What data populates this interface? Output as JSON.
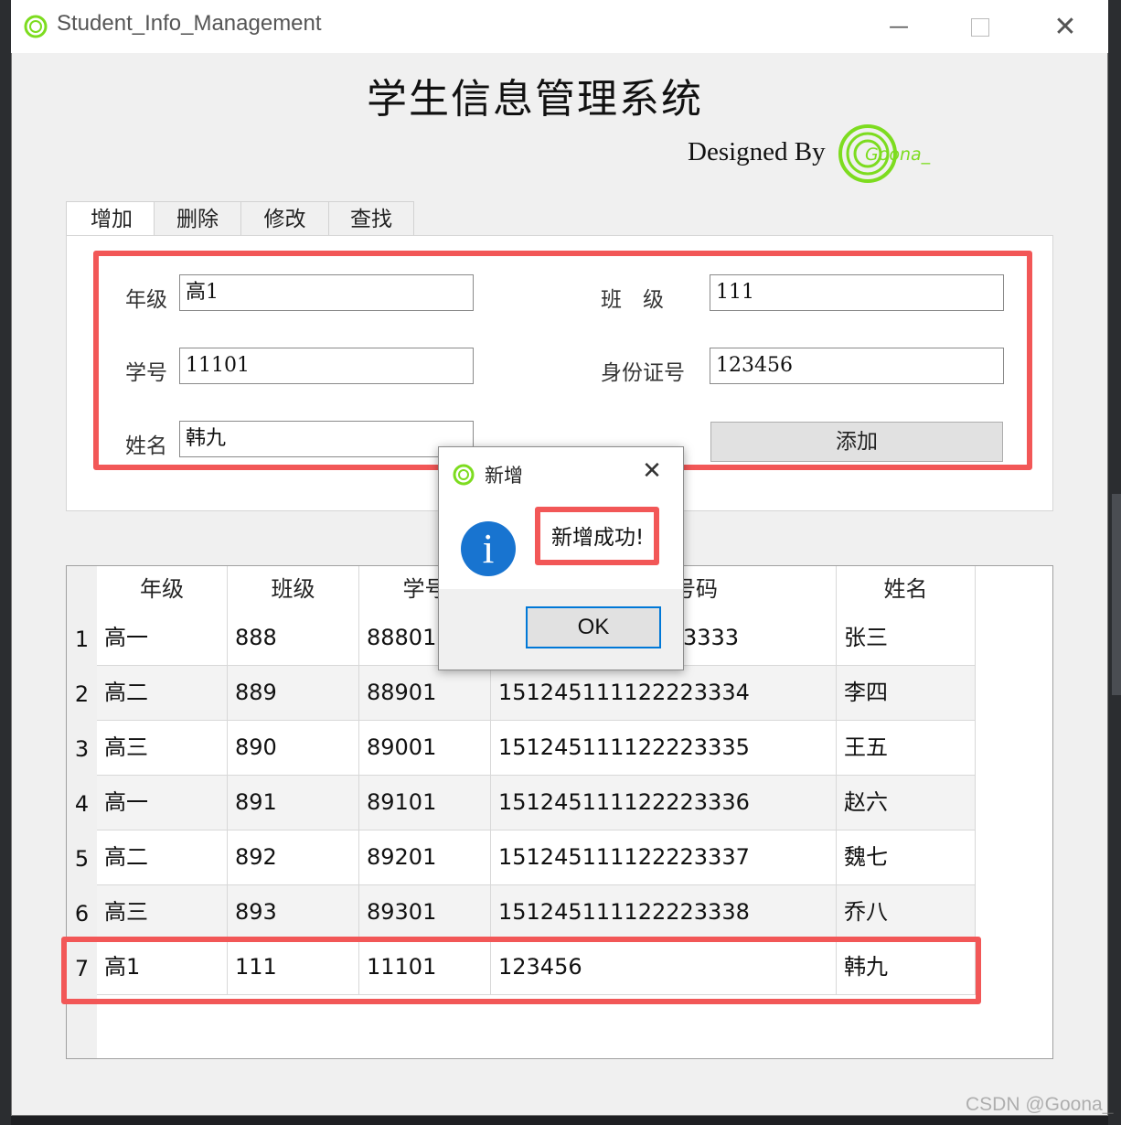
{
  "window": {
    "title": "Student_Info_Management",
    "minimize_icon": "minimize-icon",
    "maximize_icon": "maximize-icon",
    "close_icon": "close-icon"
  },
  "header": {
    "heading": "学生信息管理系统",
    "designed_by": "Designed By",
    "logo_text": "Goona_"
  },
  "tabs": [
    {
      "label": "增加",
      "active": true
    },
    {
      "label": "删除",
      "active": false
    },
    {
      "label": "修改",
      "active": false
    },
    {
      "label": "查找",
      "active": false
    }
  ],
  "form": {
    "grade_label": "年级",
    "grade_value": "高1",
    "class_label": "班　级",
    "class_value": "111",
    "student_id_label": "学号",
    "student_id_value": "11101",
    "id_card_label": "身份证号",
    "id_card_value": "123456",
    "name_label": "姓名",
    "name_value": "韩九",
    "add_button": "添加"
  },
  "table": {
    "headers": [
      "年级",
      "班级",
      "学号",
      "号码",
      "姓名"
    ],
    "rows": [
      {
        "num": "1",
        "grade": "高一",
        "class": "888",
        "sid": "88801",
        "idcard": "3333",
        "name": "张三"
      },
      {
        "num": "2",
        "grade": "高二",
        "class": "889",
        "sid": "88901",
        "idcard": "151245111122223334",
        "name": "李四"
      },
      {
        "num": "3",
        "grade": "高三",
        "class": "890",
        "sid": "89001",
        "idcard": "151245111122223335",
        "name": "王五"
      },
      {
        "num": "4",
        "grade": "高一",
        "class": "891",
        "sid": "89101",
        "idcard": "151245111122223336",
        "name": "赵六"
      },
      {
        "num": "5",
        "grade": "高二",
        "class": "892",
        "sid": "89201",
        "idcard": "151245111122223337",
        "name": "魏七"
      },
      {
        "num": "6",
        "grade": "高三",
        "class": "893",
        "sid": "89301",
        "idcard": "151245111122223338",
        "name": "乔八"
      },
      {
        "num": "7",
        "grade": "高1",
        "class": "111",
        "sid": "11101",
        "idcard": "123456",
        "name": "韩九"
      }
    ]
  },
  "dialog": {
    "title": "新增",
    "message": "新增成功!",
    "ok": "OK",
    "icon": "info-icon"
  },
  "watermark": "CSDN @Goona_",
  "colors": {
    "highlight": "#f25757",
    "focus": "#0078d7",
    "info": "#1874d0",
    "logo": "#7ddc1f"
  }
}
